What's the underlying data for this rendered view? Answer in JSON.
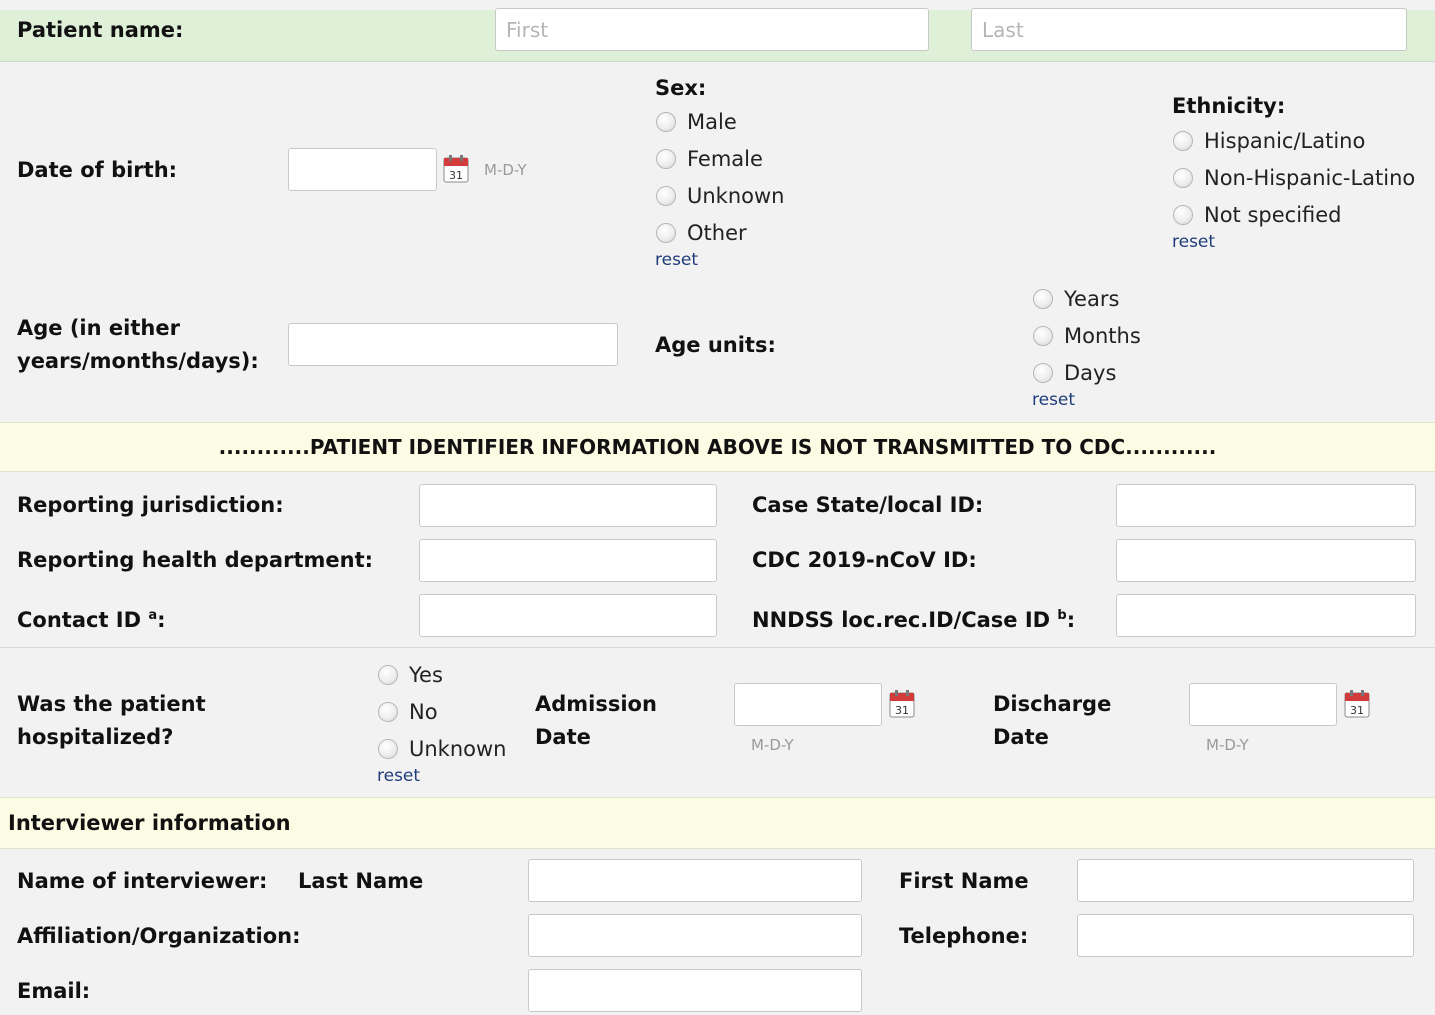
{
  "patient_name": {
    "label": "Patient name:",
    "first_placeholder": "First",
    "last_placeholder": "Last"
  },
  "dob": {
    "label": "Date of birth:",
    "format_hint": "M-D-Y"
  },
  "sex": {
    "label": "Sex:",
    "options": [
      "Male",
      "Female",
      "Unknown",
      "Other"
    ],
    "reset": "reset"
  },
  "ethnicity": {
    "label": "Ethnicity:",
    "options": [
      "Hispanic/Latino",
      "Non-Hispanic-Latino",
      "Not specified"
    ],
    "reset": "reset"
  },
  "age": {
    "label_line1": "Age (in either",
    "label_line2": "years/months/days):"
  },
  "age_units": {
    "label": "Age units:",
    "options": [
      "Years",
      "Months",
      "Days"
    ],
    "reset": "reset"
  },
  "banner": {
    "text": "............PATIENT IDENTIFIER INFORMATION ABOVE IS NOT TRANSMITTED TO CDC............"
  },
  "ids": {
    "reporting_jurisdiction": "Reporting jurisdiction:",
    "reporting_health_department": "Reporting health department:",
    "contact_id": "Contact ID",
    "contact_id_sup": "a",
    "case_state_local_id": "Case State/local ID:",
    "cdc_id": "CDC 2019-nCoV ID:",
    "nndss_id": "NNDSS loc.rec.ID/Case ID",
    "nndss_sup": "b",
    "colon": ":"
  },
  "hospital": {
    "label_line1": "Was the patient",
    "label_line2": "hospitalized?",
    "options": [
      "Yes",
      "No",
      "Unknown"
    ],
    "reset": "reset",
    "admission_line1": "Admission",
    "admission_line2": "Date",
    "discharge_line1": "Discharge",
    "discharge_line2": "Date",
    "format_hint": "M-D-Y"
  },
  "interviewer": {
    "section_title": "Interviewer information",
    "name_label": "Name of interviewer:",
    "last_name_label": "Last Name",
    "first_name_label": "First Name",
    "affiliation_label": "Affiliation/Organization:",
    "telephone_label": "Telephone:",
    "email_label": "Email:"
  },
  "calendar_icon": {
    "day": "31",
    "color": "#d23b3b"
  }
}
